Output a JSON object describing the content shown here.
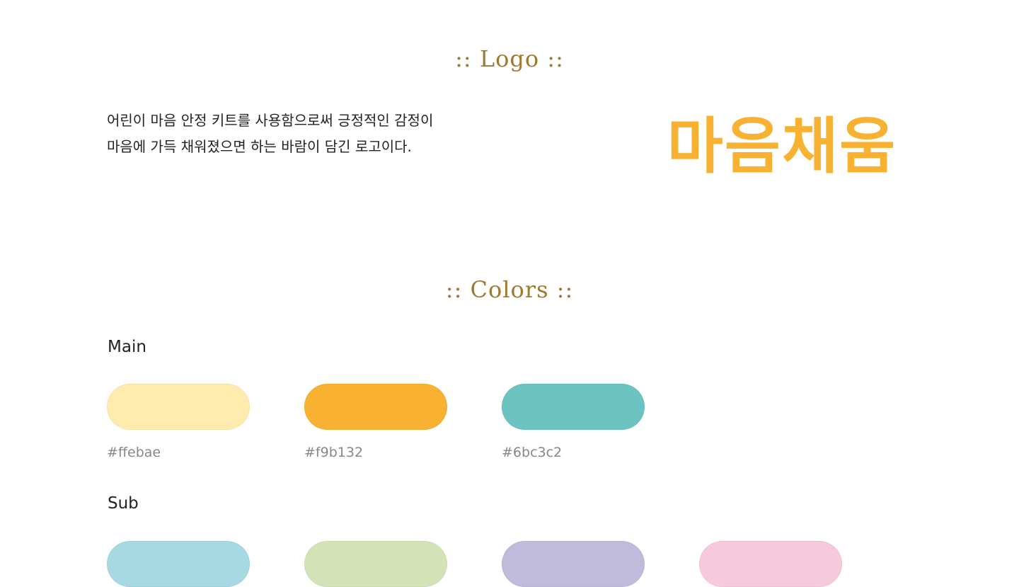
{
  "logo_section": {
    "title": ":: Logo ::",
    "description_line1": "어린이 마음 안정 키트를 사용함으로써 긍정적인 감정이",
    "description_line2": "마음에 가득 채워졌으면 하는 바람이 담긴 로고이다.",
    "logo_text": "마음채움",
    "logo_color": "#f9b132"
  },
  "colors_section": {
    "title": ":: Colors ::",
    "main": {
      "label": "Main",
      "swatches": [
        {
          "hex": "#ffebae",
          "label": "#ffebae"
        },
        {
          "hex": "#f9b132",
          "label": "#f9b132"
        },
        {
          "hex": "#6bc3c2",
          "label": "#6bc3c2"
        }
      ]
    },
    "sub": {
      "label": "Sub",
      "swatches": [
        {
          "hex": "#a6d9e2"
        },
        {
          "hex": "#d4e3b7"
        },
        {
          "hex": "#c0badb"
        },
        {
          "hex": "#f7c9dc"
        }
      ]
    }
  }
}
